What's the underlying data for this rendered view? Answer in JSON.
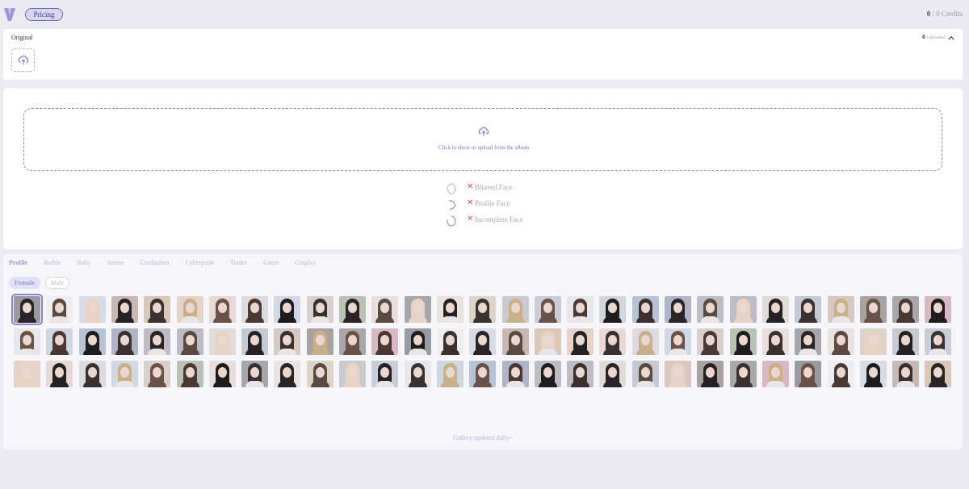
{
  "header": {
    "logo_letter": "V",
    "pricing_label": "Pricing",
    "credits_used": "0",
    "credits_sep": " / ",
    "credits_total": "0 Credits"
  },
  "original": {
    "label": "Original",
    "uploaded_count": "0",
    "uploaded_label": "Uploaded"
  },
  "upload": {
    "prompt": "Click to shoot or upload from the album",
    "warnings": [
      "Blurred Face",
      "Profile Face",
      "Incomplete Face"
    ]
  },
  "gallery": {
    "tabs": [
      "Profile",
      "Barbie",
      "Baby",
      "Anime",
      "Graduation",
      "Cyberpunk",
      "Tinder",
      "Game",
      "Cosplay"
    ],
    "active_tab": "Profile",
    "genders": [
      "Female",
      "Male"
    ],
    "active_gender": "Female",
    "footer": "Gallery updated daily~",
    "thumbnail_count": 87,
    "bg_palette": [
      "#9a9aa2",
      "#d9c7c1",
      "#bdbdc3",
      "#e7e6ea",
      "#e9e3df",
      "#d8d0cc",
      "#e6d2c6",
      "#efeeee",
      "#a8a2a0",
      "#bdbcc4",
      "#cfd6de",
      "#ddd3c6",
      "#b9c2b5",
      "#e9d8d4",
      "#d8dde5",
      "#a9a8a8",
      "#e0dcd8",
      "#b7c2d5",
      "#c9c9d0",
      "#e8dedb",
      "#dcdbe0",
      "#c9b7b4",
      "#d8b9c3",
      "#c4c9d4",
      "#b0b4c7",
      "#c9ccd9",
      "#a6a6ab",
      "#cfd8e4",
      "#d9c8b9"
    ],
    "hair_palette": [
      "#2b2426",
      "#4a3834",
      "#3a3230",
      "#5a4a42",
      "#1f1c1e",
      "#c9b08a",
      "#e8d2c4",
      "#3c302e",
      "#6a5248",
      "#262224"
    ]
  }
}
